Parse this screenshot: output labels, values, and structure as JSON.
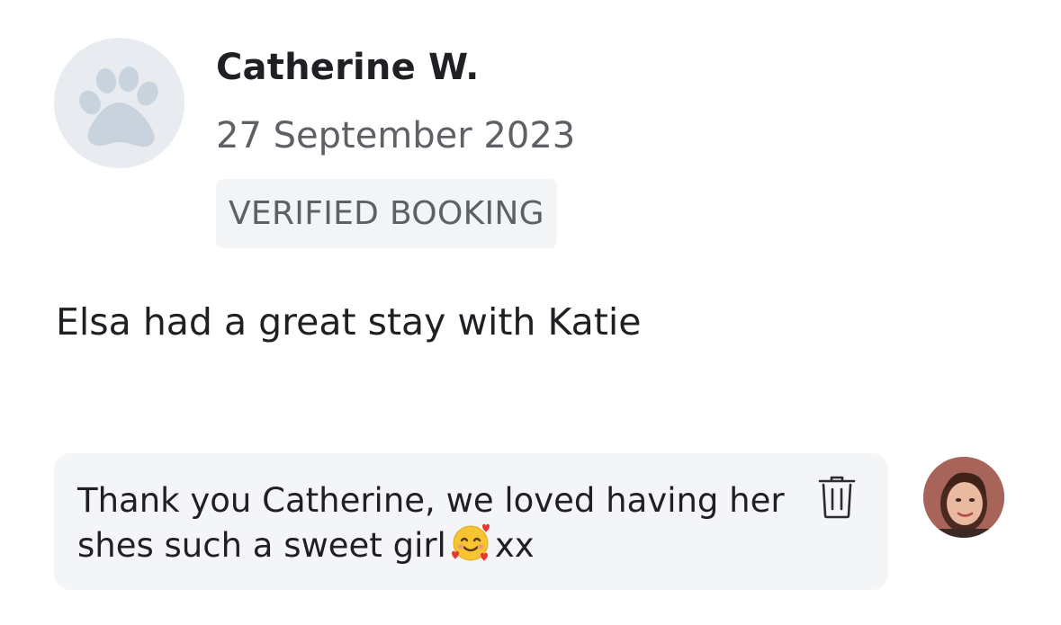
{
  "review": {
    "reviewer_name": "Catherine W.",
    "date": "27 September 2023",
    "badge": "VERIFIED BOOKING",
    "text": "Elsa had a great stay with Katie"
  },
  "reply": {
    "line1": "Thank you Catherine, we loved having her",
    "line2_before": "shes such a sweet girl",
    "line2_after": "xx",
    "emoji": "smiling-face-with-hearts"
  },
  "icons": {
    "reviewer_avatar": "paw-icon",
    "delete": "trash-icon",
    "host_avatar": "profile-photo"
  },
  "colors": {
    "name": "#1f1f24",
    "secondary_text": "#5e6066",
    "badge_bg": "#f2f4f6",
    "avatar_bg": "#e8ecf0",
    "paw": "#c8d3de",
    "bubble_bg": "#f3f5f7"
  }
}
